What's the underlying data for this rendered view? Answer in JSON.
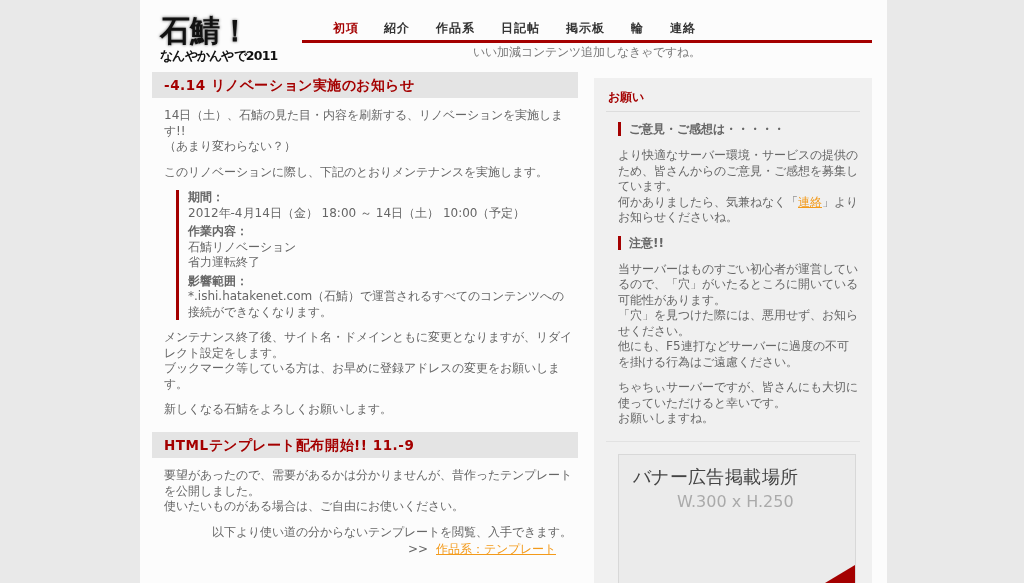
{
  "logo": {
    "title": "石鯖！",
    "subtitle": "なんやかんやで2011"
  },
  "nav": [
    {
      "label": "初項",
      "selected": true
    },
    {
      "label": "紹介",
      "selected": false
    },
    {
      "label": "作品系",
      "selected": false
    },
    {
      "label": "日記帖",
      "selected": false
    },
    {
      "label": "掲示板",
      "selected": false
    },
    {
      "label": "輪",
      "selected": false
    },
    {
      "label": "連絡",
      "selected": false
    }
  ],
  "tagline": "いい加減コンテンツ追加しなきゃですね。",
  "articles": [
    {
      "title": "-4.14 リノベーション実施のお知らせ",
      "blocks": [
        {
          "kind": "paragraph",
          "lines": [
            "14日（土）、石鯖の見た目・内容を刷新する、リノベーションを実施します!!",
            "（あまり変わらない？）"
          ]
        },
        {
          "kind": "paragraph",
          "lines": [
            "このリノベーションに際し、下記のとおりメンテナンスを実施します。"
          ]
        },
        {
          "kind": "details",
          "items": [
            {
              "label": "期間：",
              "lines": [
                "2012年-4月14日（金） 18:00 ～ 14日（土） 10:00（予定）"
              ]
            },
            {
              "label": "作業内容：",
              "lines": [
                "石鯖リノベーション",
                "省力運転終了"
              ]
            },
            {
              "label": "影響範囲：",
              "lines": [
                "*.ishi.hatakenet.com（石鯖）で運営されるすべてのコンテンツへの接続ができなくなります。"
              ]
            }
          ]
        },
        {
          "kind": "paragraph",
          "lines": [
            "メンテナンス終了後、サイト名・ドメインともに変更となりますが、リダイレクト設定をします。",
            "ブックマーク等している方は、お早めに登録アドレスの変更をお願いします。"
          ]
        },
        {
          "kind": "paragraph",
          "lines": [
            "新しくなる石鯖をよろしくお願いします。"
          ]
        }
      ]
    },
    {
      "title": "HTMLテンプレート配布開始!! 11.-9",
      "blocks": [
        {
          "kind": "paragraph",
          "lines": [
            "要望があったので、需要があるかは分かりませんが、昔作ったテンプレートを公開しました。",
            "使いたいものがある場合は、ご自由にお使いください。"
          ]
        },
        {
          "kind": "more",
          "text": "以下より使い道の分からないテンプレートを閲覧、入手できます。",
          "prefix": ">>",
          "link": "作品系：テンプレート"
        }
      ]
    }
  ],
  "sidebar": {
    "title": "お願い",
    "sections": [
      {
        "heading": "ご意見・ご感想は・・・・・",
        "paragraphs": [
          [
            [
              {
                "kind": "text",
                "text": "より快適なサーバー環境・サービスの提供のため、皆さんからのご意見・ご感想を募集しています。"
              }
            ],
            [
              {
                "kind": "text",
                "text": "何かありましたら、気兼ねなく「"
              },
              {
                "kind": "link",
                "text": "連絡"
              },
              {
                "kind": "text",
                "text": "」よりお知らせくださいね。"
              }
            ]
          ]
        ]
      },
      {
        "heading": "注意!!",
        "paragraphs": [
          [
            [
              {
                "kind": "text",
                "text": "当サーバーはものすごい初心者が運営しているので、「穴」がいたるところに開いている可能性があります。"
              }
            ],
            [
              {
                "kind": "text",
                "text": "「穴」を見つけた際には、悪用せず、お知らせください。"
              }
            ],
            [
              {
                "kind": "text",
                "text": "他にも、F5連打などサーバーに過度の不可を掛ける行為はご遠慮ください。"
              }
            ]
          ],
          [
            [
              {
                "kind": "text",
                "text": "ちゃちぃサーバーですが、皆さんにも大切に使っていただけると幸いです。"
              }
            ],
            [
              {
                "kind": "text",
                "text": "お願いしますね。"
              }
            ]
          ]
        ]
      }
    ]
  },
  "banner": {
    "title": "バナー広告掲載場所",
    "size": "W.300 x H.250"
  }
}
